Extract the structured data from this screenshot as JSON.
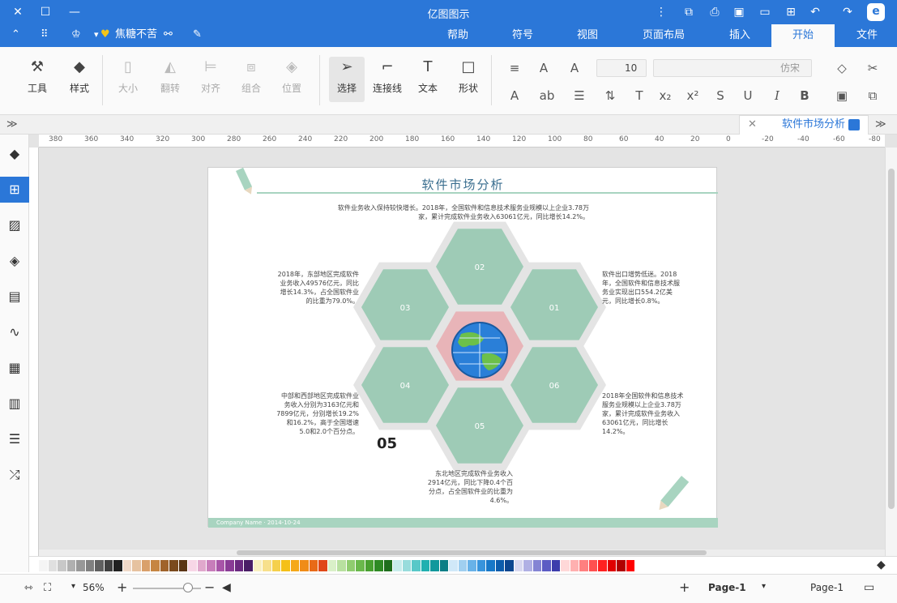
{
  "window": {
    "title": "亿图图示",
    "controls": [
      "close-icon",
      "maximize-icon",
      "minimize-icon"
    ]
  },
  "quick_access": {
    "user": "焦糖不苦",
    "icons": [
      "collapse-icon",
      "apps-icon",
      "shirt-icon",
      "share-icon",
      "pen-icon"
    ],
    "right_icons": [
      "more-icon",
      "open-icon",
      "print-icon",
      "save-icon",
      "folder-icon",
      "new-icon",
      "undo-icon",
      "redo-icon",
      "logo-icon"
    ]
  },
  "menu": {
    "tabs": [
      "文件",
      "开始",
      "插入",
      "页面布局",
      "视图",
      "符号",
      "帮助"
    ],
    "active": "开始"
  },
  "ribbon": {
    "tools": [
      {
        "label": "工具",
        "icon": "tool-icon"
      },
      {
        "label": "样式",
        "icon": "fill-icon"
      },
      {
        "label": "大小",
        "icon": "size-icon"
      },
      {
        "label": "翻转",
        "icon": "flip-icon"
      },
      {
        "label": "对齐",
        "icon": "align-icon"
      },
      {
        "label": "组合",
        "icon": "group-icon"
      },
      {
        "label": "位置",
        "icon": "layer-icon"
      },
      {
        "label": "选择",
        "icon": "select-icon"
      },
      {
        "label": "连接线",
        "icon": "connector-icon"
      },
      {
        "label": "文本",
        "icon": "text-icon"
      },
      {
        "label": "形状",
        "icon": "shape-icon"
      }
    ],
    "font_name": "仿宋",
    "font_size": "10"
  },
  "document": {
    "tab_label": "软件市场分析"
  },
  "ruler_labels": [
    "380",
    "360",
    "340",
    "320",
    "300",
    "280",
    "260",
    "240",
    "220",
    "200",
    "180",
    "160",
    "140",
    "120",
    "100",
    "80",
    "60",
    "40",
    "20",
    "0",
    "-20",
    "-40",
    "-60",
    "-80"
  ],
  "diagram": {
    "title": "软件市场分析",
    "big_number": "05",
    "footer": "Company Name · 2014-10-24",
    "hexagons": [
      {
        "label": "02"
      },
      {
        "label": "01"
      },
      {
        "label": "03"
      },
      {
        "label": "06"
      },
      {
        "label": "04"
      },
      {
        "label": "05"
      }
    ],
    "paragraphs": {
      "top": "软件业务收入保持较快增长。2018年，全国软件和信息技术服务业规模以上企业3.78万家，累计完成软件业务收入63061亿元，同比增长14.2%。",
      "left_top": "2018年，东部地区完成软件业务收入49576亿元，同比增长14.3%，占全国软件业的比重为79.0%。",
      "right_top": "软件出口增势低迷。2018年，全国软件和信息技术服务业实现出口554.2亿美元，同比增长0.8%。",
      "left_bottom": "中部和西部地区完成软件业务收入分别为3163亿元和7899亿元，分别增长19.2%和16.2%，高于全国增速5.0和2.0个百分点。",
      "right_bottom": "2018年全国软件和信息技术服务业规模以上企业3.78万家，累计完成软件业务收入63061亿元，同比增长14.2%。",
      "bottom": "东北地区完成软件业务收入2914亿元，同比下降0.4个百分点，占全国软件业的比重为4.6%。"
    }
  },
  "palette_colors": [
    "#f5f5f5",
    "#e0e0e0",
    "#c8c8c8",
    "#b0b0b0",
    "#989898",
    "#808080",
    "#606060",
    "#404040",
    "#202020",
    "#f0d9c8",
    "#e6c2a0",
    "#d9a06b",
    "#c68642",
    "#a0632b",
    "#7a4a1e",
    "#5a3414",
    "#f7d6e6",
    "#e0a8cc",
    "#c77dba",
    "#a855a8",
    "#8a3c96",
    "#6b2a80",
    "#4a1e66",
    "#f9f0c0",
    "#f7e08c",
    "#f5d04c",
    "#f5c018",
    "#f5a818",
    "#f08c18",
    "#e86a18",
    "#e04818",
    "#d9f0c8",
    "#b8e0a0",
    "#90cc70",
    "#6ab84c",
    "#48a030",
    "#2e8a24",
    "#1e6e1c",
    "#c8ecec",
    "#98dcdc",
    "#58c8c8",
    "#20b0b0",
    "#10989c",
    "#0c7e86",
    "#d0e8f8",
    "#a0cff0",
    "#68b2e8",
    "#3894dc",
    "#1878c8",
    "#0c5cac",
    "#0c4690",
    "#d8d8f0",
    "#b0b0e4",
    "#8484d4",
    "#5c5cc4",
    "#3c3cac",
    "#ffd8d8",
    "#ffb0b0",
    "#ff8080",
    "#ff5050",
    "#ff2020",
    "#e00000",
    "#b00000",
    "#ff0000"
  ],
  "status": {
    "page_nav": "Page-1",
    "page_select": "Page-1",
    "zoom": "56%"
  }
}
